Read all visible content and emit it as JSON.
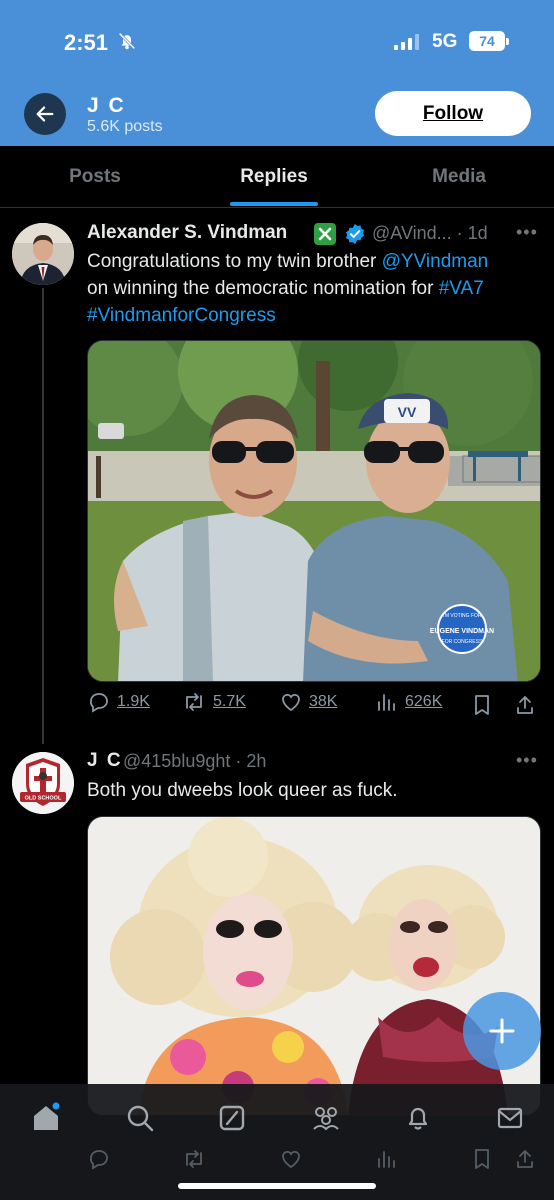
{
  "status_bar": {
    "time": "2:51",
    "network": "5G",
    "battery": "74"
  },
  "header": {
    "name": "J C",
    "posts": "5.6K posts",
    "follow_label": "Follow"
  },
  "tabs": [
    {
      "label": "Posts",
      "active": false
    },
    {
      "label": "Replies",
      "active": true
    },
    {
      "label": "Media",
      "active": false
    }
  ],
  "tweet1": {
    "author": "Alexander S. Vindman",
    "handle_time": "@AVind... · 1d",
    "text_line1": "Congratulations to my twin brother ",
    "mention": "@YVindman",
    "text_line2": "on winning the democratic nomination for ",
    "hashtag1": "#VA7",
    "hashtag2": "#VindmanforCongress",
    "photo_cap_text": "VV",
    "button_top": "I'M VOTING FOR",
    "button_main": "EUGENE VINDMAN",
    "button_bottom": "FOR CONGRESS",
    "stats": {
      "replies": "1.9K",
      "reposts": "5.7K",
      "likes": "38K",
      "views": "626K"
    }
  },
  "tweet2": {
    "author": "J C",
    "handle_time": "@415blu9ght · 2h",
    "text": "Both you dweebs look queer as fuck.",
    "badge_text": "OLD SCHOOL"
  },
  "colors": {
    "header_blue": "#4a90d9",
    "accent": "#1d9bf0",
    "background": "#000000",
    "muted": "#71767b"
  },
  "icons": [
    "bell-slash-icon",
    "signal-icon",
    "back-arrow-icon",
    "verified-badge-icon",
    "green-check-badge-icon",
    "more-icon",
    "reply-icon",
    "repost-icon",
    "like-icon",
    "views-icon",
    "bookmark-icon",
    "share-icon",
    "home-icon",
    "search-icon",
    "grok-icon",
    "communities-icon",
    "notifications-icon",
    "messages-icon",
    "compose-plus-icon"
  ]
}
